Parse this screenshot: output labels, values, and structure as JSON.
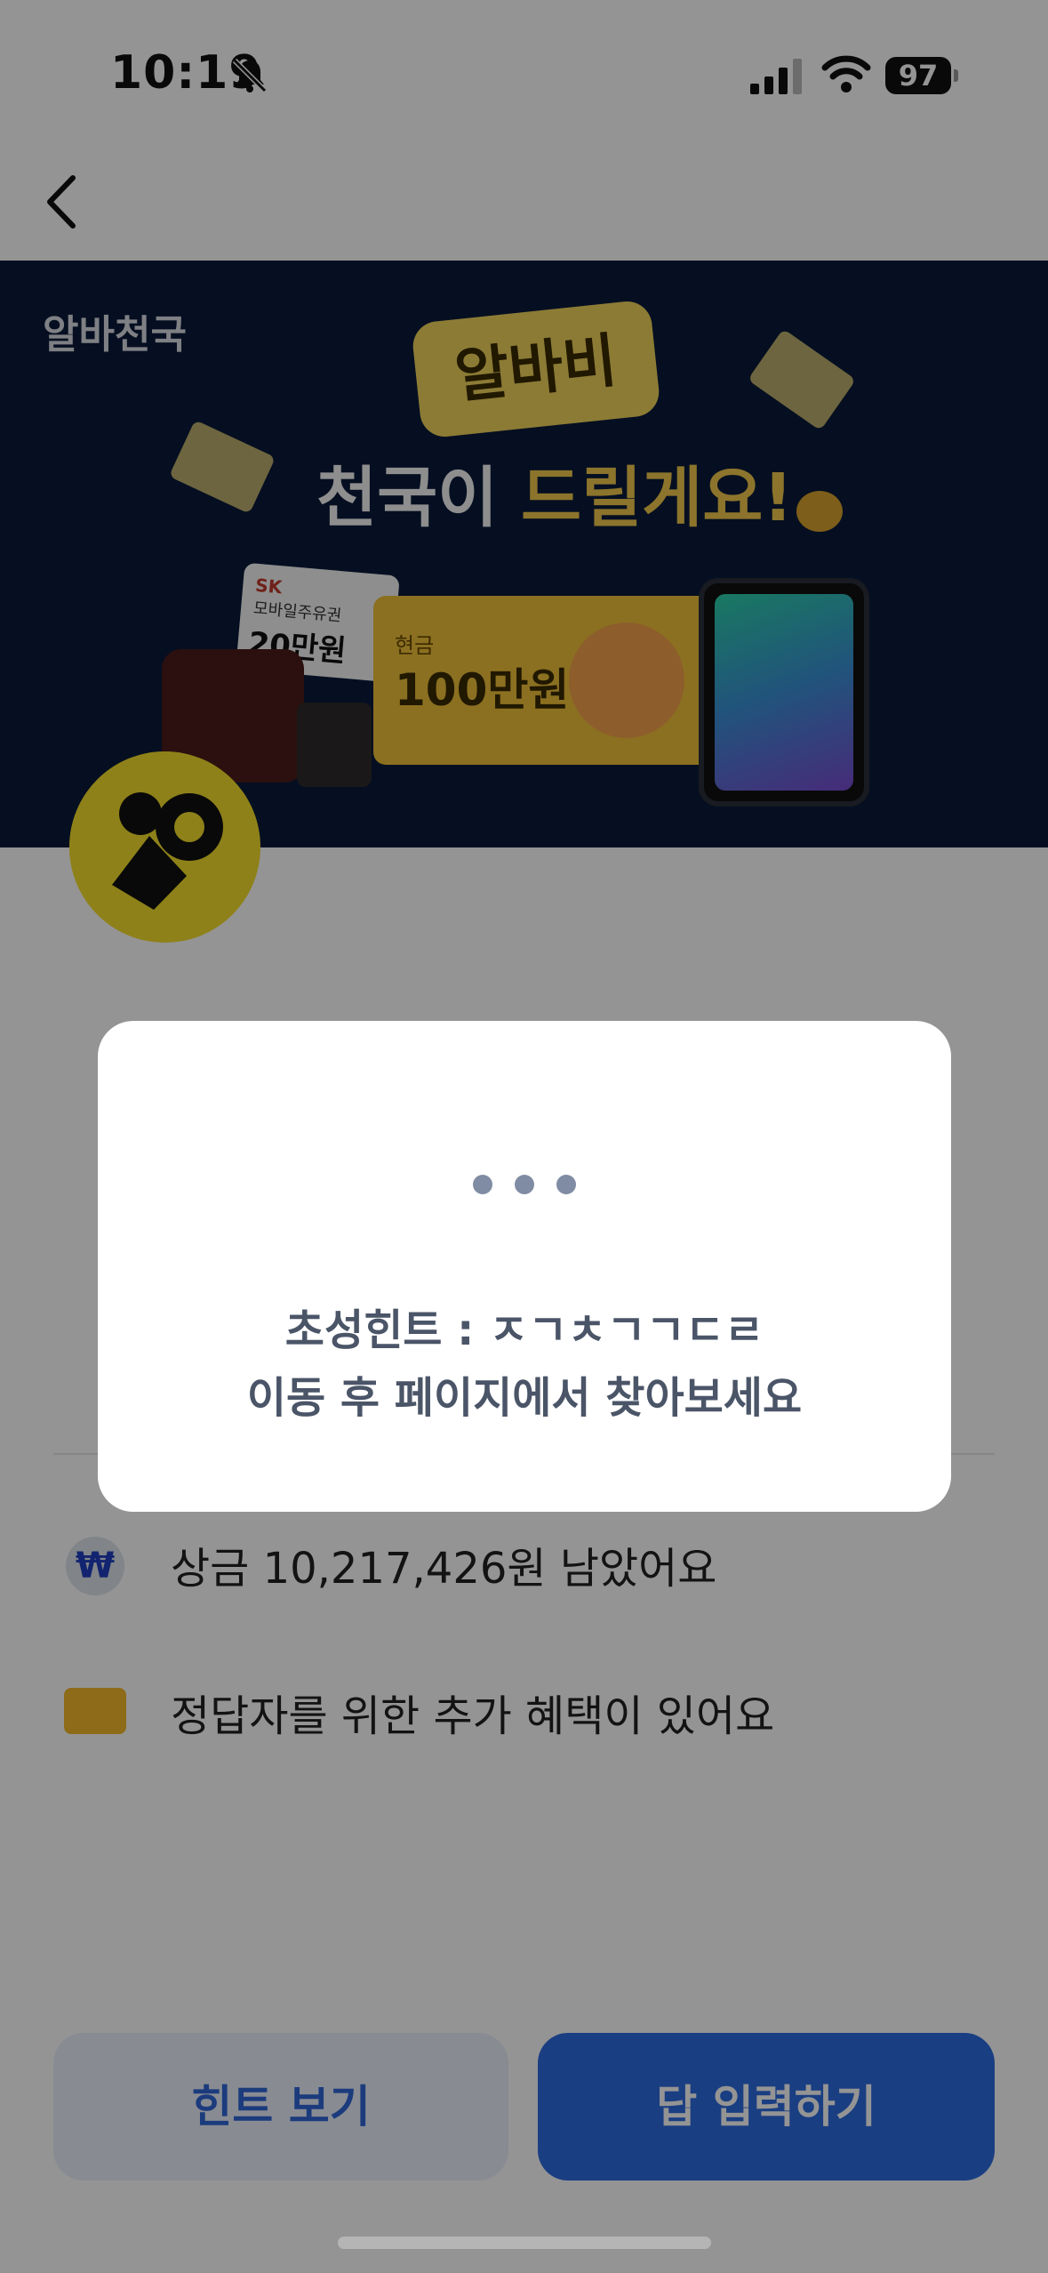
{
  "status_bar": {
    "time": "10:19",
    "battery": "97",
    "icons": [
      "bell-slash-icon",
      "signal-icon",
      "wifi-icon",
      "battery-icon"
    ]
  },
  "nav": {
    "back_icon": "chevron-left-icon"
  },
  "banner": {
    "brand": "알바천국",
    "tag": "알바비",
    "headline_part1": "천국이 ",
    "headline_part2": "드릴게요!",
    "coupon_brand": "SK",
    "coupon_desc": "모바일주유권",
    "coupon_amount": "20만원",
    "cash_label": "현금",
    "cash_amount": "100만원"
  },
  "info": {
    "prize_text": "상금 10,217,426원 남았어요",
    "bonus_text": "정답자를 위한 추가 혜택이 있어요",
    "won_symbol": "₩"
  },
  "buttons": {
    "hint_label": "힌트 보기",
    "answer_label": "답 입력하기"
  },
  "modal": {
    "hint_line1": "초성힌트 : ㅈㄱㅊㄱㄱㄷㄹ",
    "hint_line2": "이동 후 페이지에서 찾아보세요"
  },
  "colors": {
    "banner_bg": "#0a1a3a",
    "accent_yellow": "#f2c94c",
    "primary_blue": "#2d6be0",
    "modal_text": "#4b5568"
  }
}
